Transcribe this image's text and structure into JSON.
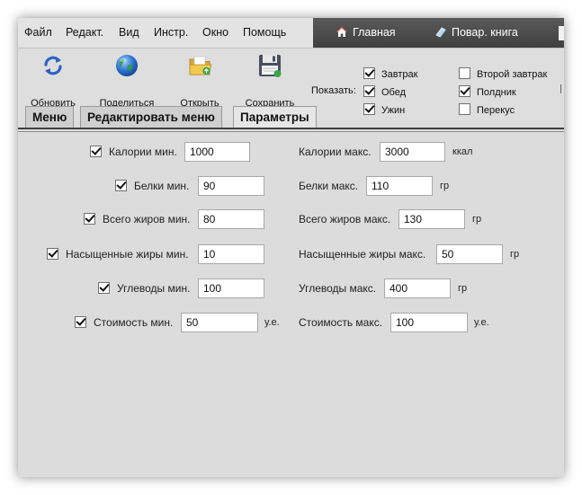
{
  "menu": [
    "Файл",
    "Редакт.",
    "Вид",
    "Инстр.",
    "Окно",
    "Помощь"
  ],
  "nav": {
    "home": "Главная",
    "cookbook": "Повар. книга"
  },
  "toolbar": {
    "refresh": "Обновить",
    "share": "Поделиться",
    "open": "Открыть",
    "save": "Сохранить"
  },
  "show": {
    "label": "Показать:",
    "meals": [
      {
        "label": "Завтрак",
        "checked": true
      },
      {
        "label": "Обед",
        "checked": true
      },
      {
        "label": "Ужин",
        "checked": true
      },
      {
        "label": "Второй завтрак",
        "checked": false
      },
      {
        "label": "Полдник",
        "checked": true
      },
      {
        "label": "Перекус",
        "checked": false
      }
    ]
  },
  "tabs": [
    "Меню",
    "Редактировать меню",
    "Параметры"
  ],
  "active_tab": 2,
  "params": [
    {
      "min_label": "Калории мин.",
      "min": "1000",
      "max_label": "Калории макс.",
      "max": "3000",
      "unit": "ккал",
      "checked": true
    },
    {
      "min_label": "Белки мин.",
      "min": "90",
      "max_label": "Белки макс.",
      "max": "110",
      "unit": "гр",
      "checked": true
    },
    {
      "min_label": "Всего жиров мин.",
      "min": "80",
      "max_label": "Всего жиров макс.",
      "max": "130",
      "unit": "гр",
      "checked": true
    },
    {
      "min_label": "Насыщенные жиры мин.",
      "min": "10",
      "max_label": "Насыщенные жиры макс.",
      "max": "50",
      "unit": "гр",
      "checked": true
    },
    {
      "min_label": "Углеводы мин.",
      "min": "100",
      "max_label": "Углеводы макс.",
      "max": "400",
      "unit": "гр",
      "checked": true
    },
    {
      "min_label": "Стоимость мин.",
      "min": "50",
      "max_label": "Стоимость макс.",
      "max": "100",
      "unit": "у.е.",
      "checked": true
    }
  ],
  "colors": {
    "window_bg": "#dcdcdc",
    "nav_strip": "#4a4a4a",
    "accent_home": "#e04020"
  },
  "icons": {
    "refresh": "refresh-icon",
    "share": "globe-icon",
    "open": "folder-icon",
    "save": "floppy-icon",
    "home": "home-icon",
    "cookbook": "book-icon"
  }
}
